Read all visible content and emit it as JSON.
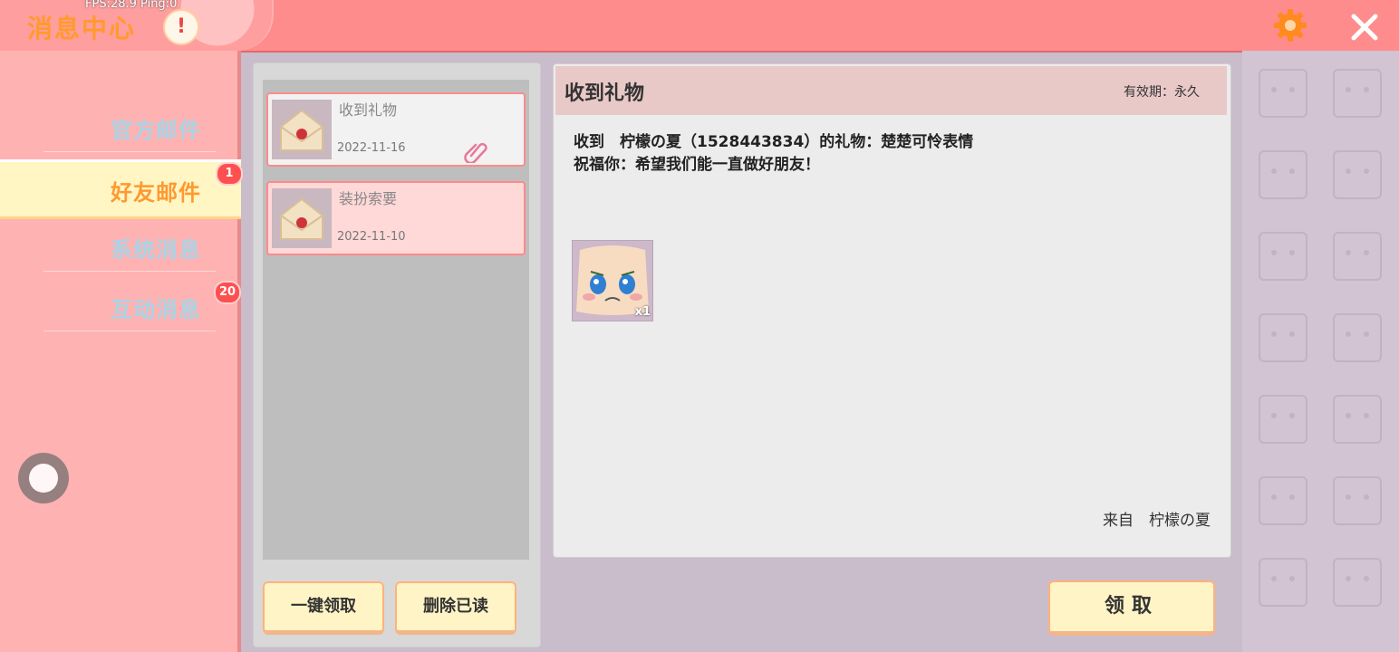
{
  "header": {
    "title": "消息中心",
    "fps_text": "FPS:28.9 Ping:0",
    "alert_icon": "exclamation-icon",
    "settings_icon": "gear-icon",
    "close_icon": "close-icon"
  },
  "sidebar": {
    "items": [
      {
        "label": "官方邮件",
        "badge": ""
      },
      {
        "label": "好友邮件",
        "badge": "1"
      },
      {
        "label": "系统消息",
        "badge": ""
      },
      {
        "label": "互动消息",
        "badge": "20"
      }
    ]
  },
  "mail_list": {
    "items": [
      {
        "title": "收到礼物",
        "date": "2022-11-16",
        "has_attachment": true
      },
      {
        "title": "装扮索要",
        "date": "2022-11-10",
        "has_attachment": false
      }
    ],
    "claim_all_label": "一键领取",
    "delete_read_label": "删除已读"
  },
  "detail": {
    "title": "收到礼物",
    "validity": "有效期：永久",
    "line1": "收到　柠檬の夏（1528443834）的礼物：楚楚可怜表情",
    "line2": "祝福你：希望我们能一直做好朋友！",
    "gift_quantity": "x1",
    "from": "来自　柠檬の夏",
    "claim_label": "领取"
  },
  "colors": {
    "accent": "#ff9930",
    "topbar": "#ff8c8c",
    "sidebar": "#ffb2b2",
    "badge": "#ff5050"
  }
}
